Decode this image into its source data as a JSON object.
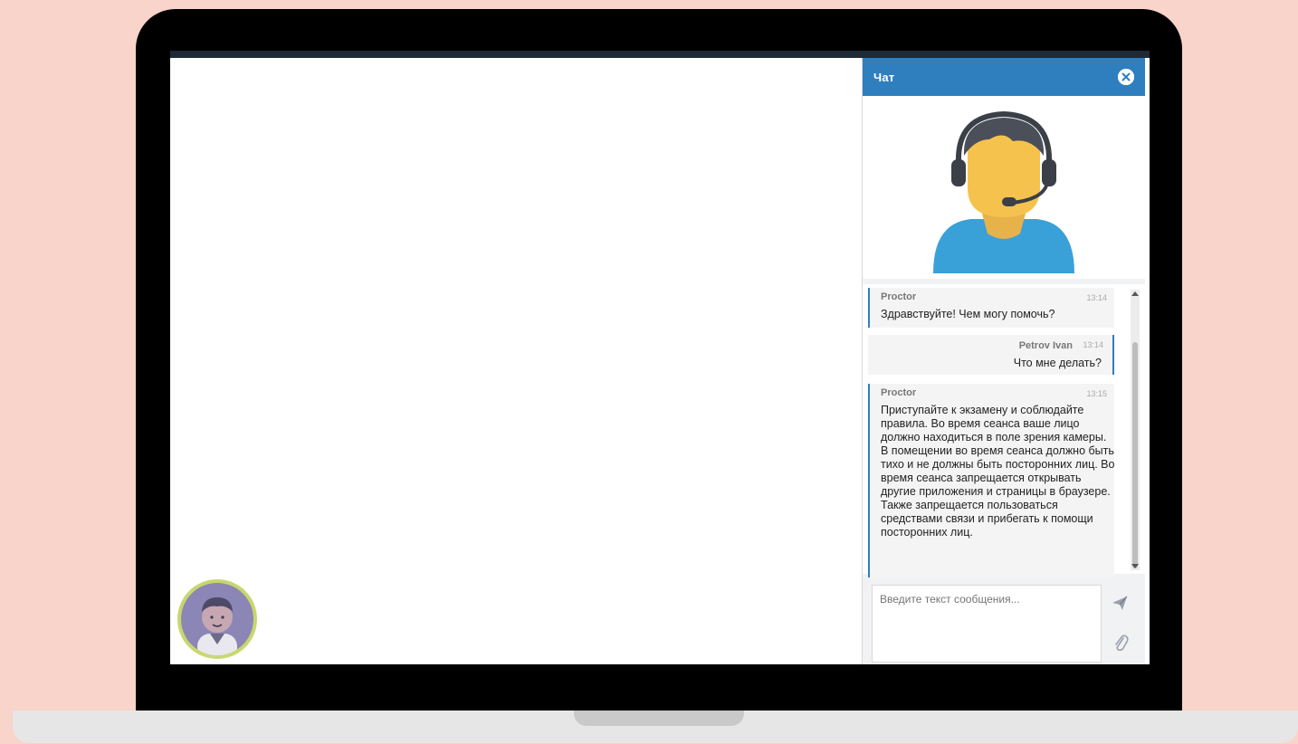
{
  "chat": {
    "title": "Чат",
    "input_placeholder": "Введите текст сообщения...",
    "messages": [
      {
        "author": "Proctor",
        "time": "13:14",
        "text": "Здравствуйте! Чем могу помочь?"
      },
      {
        "author": "Petrov Ivan",
        "time": "13:14",
        "text": "Что мне делать?"
      },
      {
        "author": "Proctor",
        "time": "13:15",
        "text": "Приступайте к экзамену и соблюдайте правила. Во время сеанса ваше лицо должно находиться в поле зрения камеры. В помещении во время сеанса должно быть тихо и не должны быть посторонних лиц. Во время сеанса запрещается открывать другие приложения и страницы в браузере. Также запрещается пользоваться средствами связи и прибегать к помощи посторонних лиц."
      }
    ]
  },
  "icons": {
    "close": "close-circle-icon",
    "send": "send-paper-plane-icon",
    "attach": "paperclip-icon",
    "agent": "support-agent-headset-icon",
    "user_avatar": "user-avatar-icon"
  },
  "colors": {
    "accent": "#2f7fbf",
    "background": "#f9d4ca",
    "chat_panel": "#f1f2f4"
  }
}
